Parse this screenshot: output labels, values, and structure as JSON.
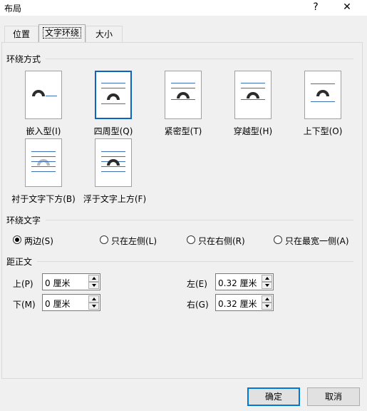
{
  "window": {
    "title": "布局",
    "help_glyph": "?",
    "close_glyph": "✕"
  },
  "tabs": [
    {
      "label": "位置",
      "active": false
    },
    {
      "label": "文字环绕",
      "active": true
    },
    {
      "label": "大小",
      "active": false
    }
  ],
  "wrap_style": {
    "header": "环绕方式",
    "options": [
      {
        "id": "inline",
        "label": "嵌入型(I)",
        "selected": false
      },
      {
        "id": "square",
        "label": "四周型(Q)",
        "selected": true
      },
      {
        "id": "tight",
        "label": "紧密型(T)",
        "selected": false
      },
      {
        "id": "through",
        "label": "穿越型(H)",
        "selected": false
      },
      {
        "id": "top-bottom",
        "label": "上下型(O)",
        "selected": false
      },
      {
        "id": "behind",
        "label": "衬于文字下方(B)",
        "selected": false
      },
      {
        "id": "front",
        "label": "浮于文字上方(F)",
        "selected": false
      }
    ]
  },
  "wrap_text": {
    "header": "环绕文字",
    "options": [
      {
        "label": "两边(S)",
        "checked": true
      },
      {
        "label": "只在左侧(L)",
        "checked": false
      },
      {
        "label": "只在右侧(R)",
        "checked": false
      },
      {
        "label": "只在最宽一侧(A)",
        "checked": false
      }
    ]
  },
  "distance": {
    "header": "距正文",
    "top": {
      "label": "上(P)",
      "value": "0 厘米"
    },
    "bottom": {
      "label": "下(M)",
      "value": "0 厘米"
    },
    "left": {
      "label": "左(E)",
      "value": "0.32 厘米"
    },
    "right": {
      "label": "右(G)",
      "value": "0.32 厘米"
    }
  },
  "buttons": {
    "ok": "确定",
    "cancel": "取消"
  }
}
